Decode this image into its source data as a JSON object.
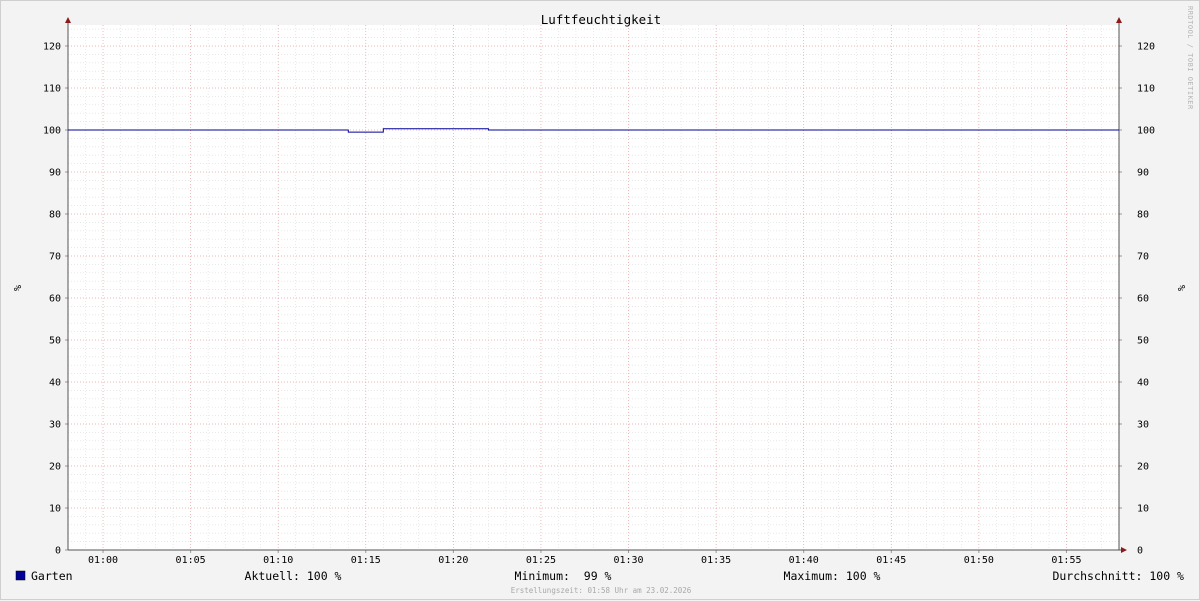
{
  "chart_data": {
    "type": "line",
    "title": "Luftfeuchtigkeit",
    "ylabel": "%",
    "ylabel_right": "%",
    "ylim": [
      0,
      125
    ],
    "y_ticks": [
      0,
      10,
      20,
      30,
      40,
      50,
      60,
      70,
      80,
      90,
      100,
      110,
      120
    ],
    "x_ticks": [
      "01:00",
      "01:05",
      "01:10",
      "01:15",
      "01:20",
      "01:25",
      "01:30",
      "01:35",
      "01:40",
      "01:45",
      "01:50",
      "01:55"
    ],
    "x_range": [
      "00:58",
      "01:58"
    ],
    "grid": true,
    "series": [
      {
        "name": "Garten",
        "color": "#000099",
        "x": [
          "00:58",
          "01:14",
          "01:14",
          "01:16",
          "01:16",
          "01:22",
          "01:22",
          "01:58"
        ],
        "values": [
          100,
          100,
          99.5,
          99.5,
          100.3,
          100.3,
          100,
          100
        ]
      }
    ],
    "legend": {
      "placement": "bottom",
      "series_label": "Garten",
      "current": "Aktuell: 100 %",
      "minimum": "Minimum:  99 %",
      "maximum": "Maximum: 100 %",
      "average": "Durchschnitt: 100 %"
    },
    "watermark": "RRDTOOL / TOBI OETIKER",
    "footer": "Erstellungszeit: 01:58 Uhr am 23.02.2026"
  }
}
